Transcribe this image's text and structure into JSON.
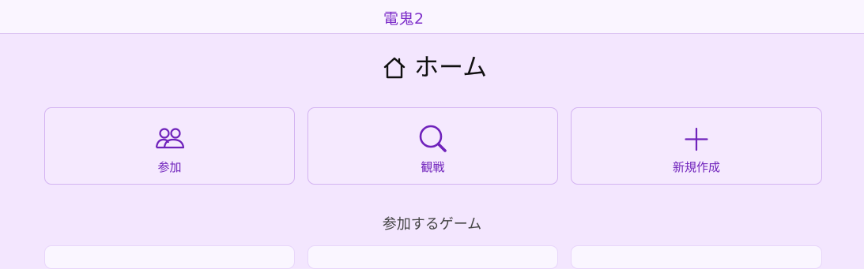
{
  "header": {
    "app_title": "電鬼2"
  },
  "home": {
    "title": "ホーム",
    "icon": "home-icon"
  },
  "actions": [
    {
      "label": "参加",
      "icon": "users-icon"
    },
    {
      "label": "観戦",
      "icon": "search-icon"
    },
    {
      "label": "新規作成",
      "icon": "plus-icon"
    }
  ],
  "games_section": {
    "title": "参加するゲーム"
  },
  "colors": {
    "accent": "#7e2fc9",
    "background": "#f3e6fe",
    "header_bg": "#faf5ff",
    "card_border": "#d3b3f1"
  }
}
